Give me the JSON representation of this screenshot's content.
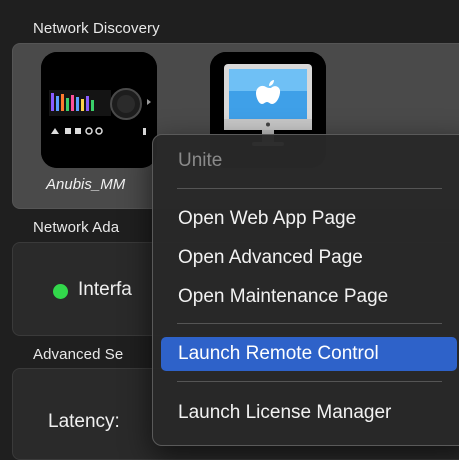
{
  "network_discovery": {
    "title": "Network Discovery",
    "devices": [
      {
        "name": "Anubis_MM",
        "icon": "anubis-device-icon"
      },
      {
        "name": "",
        "icon": "mac-computer-icon"
      }
    ]
  },
  "network_adapter": {
    "title": "Network Ada",
    "interface_label": "Interfa",
    "status_color": "#32d74b"
  },
  "advanced_settings": {
    "title": "Advanced Se",
    "latency_label": "Latency:"
  },
  "context_menu": {
    "header": "Unite",
    "items": [
      "Open Web App Page",
      "Open Advanced Page",
      "Open Maintenance Page",
      "Launch Remote Control",
      "Launch License Manager"
    ],
    "selected": "Launch Remote Control",
    "accent_color": "#2e62c9"
  }
}
